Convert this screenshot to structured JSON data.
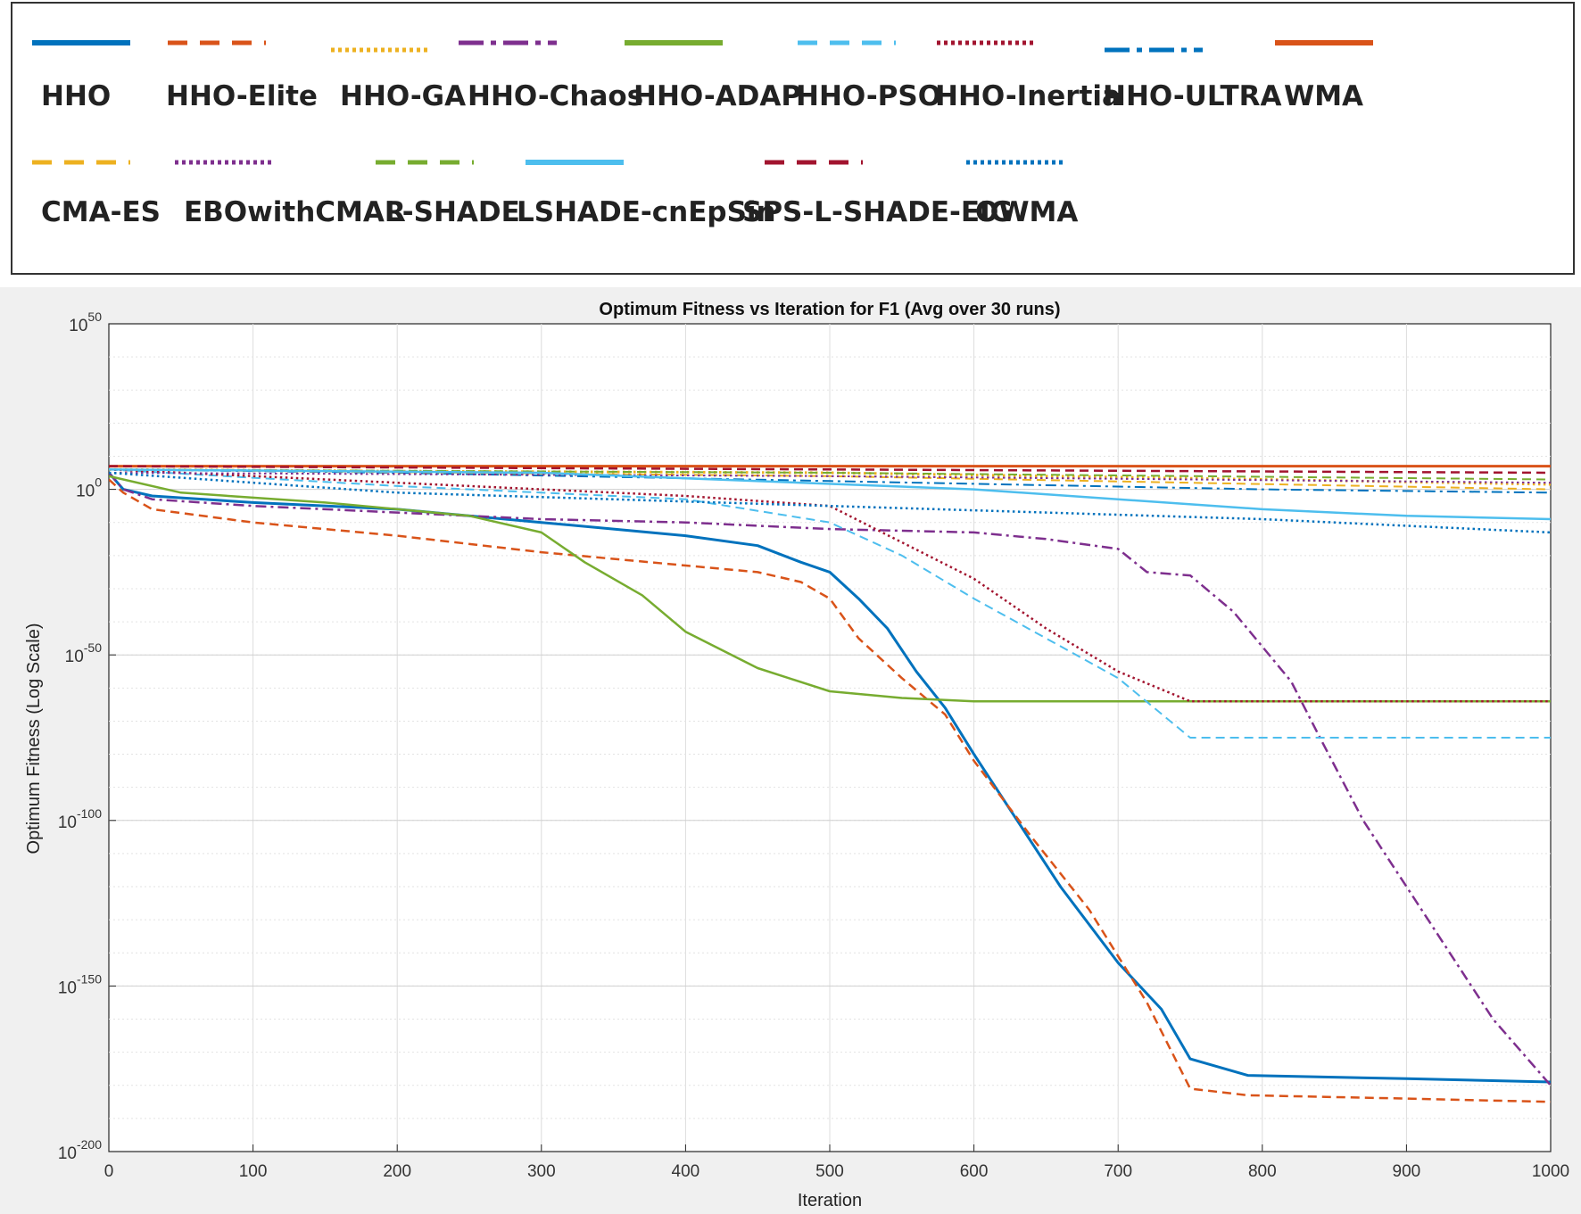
{
  "chart_data": {
    "type": "line",
    "title": "Optimum Fitness vs Iteration for F1 (Avg over 30 runs)",
    "xlabel": "Iteration",
    "ylabel": "Optimum Fitness (Log Scale)",
    "xlim": [
      0,
      1000
    ],
    "ylim_log10": [
      -200,
      50
    ],
    "yscale": "log",
    "grid": true,
    "legend_position": "top",
    "x_ticks": [
      "0",
      "100",
      "200",
      "300",
      "400",
      "500",
      "600",
      "700",
      "800",
      "900",
      "1000"
    ],
    "y_ticks": [
      {
        "base": "10",
        "exp": "50"
      },
      {
        "base": "10",
        "exp": "0"
      },
      {
        "base": "10",
        "exp": "-50"
      },
      {
        "base": "10",
        "exp": "-100"
      },
      {
        "base": "10",
        "exp": "-150"
      },
      {
        "base": "10",
        "exp": "-200"
      }
    ],
    "series": [
      {
        "name": "HHO",
        "color": "#0072bd",
        "dash": "solid",
        "width": 3,
        "points": [
          [
            0,
            5
          ],
          [
            10,
            0
          ],
          [
            30,
            -2
          ],
          [
            100,
            -4
          ],
          [
            200,
            -6
          ],
          [
            300,
            -10
          ],
          [
            350,
            -12
          ],
          [
            400,
            -14
          ],
          [
            450,
            -17
          ],
          [
            480,
            -22
          ],
          [
            500,
            -25
          ],
          [
            520,
            -33
          ],
          [
            540,
            -42
          ],
          [
            560,
            -55
          ],
          [
            580,
            -66
          ],
          [
            600,
            -80
          ],
          [
            630,
            -100
          ],
          [
            660,
            -120
          ],
          [
            700,
            -143
          ],
          [
            730,
            -157
          ],
          [
            750,
            -172
          ],
          [
            790,
            -177
          ],
          [
            900,
            -178
          ],
          [
            1000,
            -179
          ]
        ]
      },
      {
        "name": "HHO-Elite",
        "color": "#d95319",
        "dash": "dashed",
        "width": 2.5,
        "points": [
          [
            0,
            3
          ],
          [
            10,
            -1
          ],
          [
            30,
            -6
          ],
          [
            100,
            -10
          ],
          [
            200,
            -14
          ],
          [
            300,
            -19
          ],
          [
            400,
            -23
          ],
          [
            450,
            -25
          ],
          [
            480,
            -28
          ],
          [
            500,
            -33
          ],
          [
            520,
            -45
          ],
          [
            550,
            -57
          ],
          [
            580,
            -68
          ],
          [
            600,
            -82
          ],
          [
            640,
            -105
          ],
          [
            680,
            -127
          ],
          [
            720,
            -155
          ],
          [
            750,
            -181
          ],
          [
            790,
            -183
          ],
          [
            900,
            -184
          ],
          [
            1000,
            -185
          ]
        ]
      },
      {
        "name": "HHO-GA",
        "color": "#edb120",
        "dash": "dotted",
        "width": 3,
        "points": [
          [
            0,
            6
          ],
          [
            200,
            5.5
          ],
          [
            500,
            5
          ],
          [
            800,
            3
          ],
          [
            1000,
            1.5
          ]
        ]
      },
      {
        "name": "HHO-Chaos",
        "color": "#7e2f8e",
        "dash": "dashdot",
        "width": 2.5,
        "points": [
          [
            0,
            5
          ],
          [
            10,
            0
          ],
          [
            30,
            -3
          ],
          [
            100,
            -5
          ],
          [
            200,
            -7
          ],
          [
            300,
            -9
          ],
          [
            400,
            -10
          ],
          [
            500,
            -12
          ],
          [
            600,
            -13
          ],
          [
            650,
            -15
          ],
          [
            700,
            -18
          ],
          [
            720,
            -25
          ],
          [
            750,
            -26
          ],
          [
            780,
            -37
          ],
          [
            820,
            -58
          ],
          [
            840,
            -75
          ],
          [
            870,
            -100
          ],
          [
            900,
            -120
          ],
          [
            930,
            -140
          ],
          [
            960,
            -160
          ],
          [
            1000,
            -180
          ]
        ]
      },
      {
        "name": "HHO-ADAP",
        "color": "#77ac30",
        "dash": "solid",
        "width": 2.5,
        "points": [
          [
            0,
            4
          ],
          [
            50,
            -1
          ],
          [
            150,
            -4
          ],
          [
            250,
            -8
          ],
          [
            300,
            -13
          ],
          [
            330,
            -22
          ],
          [
            370,
            -32
          ],
          [
            400,
            -43
          ],
          [
            450,
            -54
          ],
          [
            500,
            -61
          ],
          [
            550,
            -63
          ],
          [
            600,
            -64
          ],
          [
            1000,
            -64
          ]
        ]
      },
      {
        "name": "HHO-PSO",
        "color": "#4dbeee",
        "dash": "dashed",
        "width": 2,
        "points": [
          [
            0,
            6
          ],
          [
            200,
            1
          ],
          [
            400,
            -3
          ],
          [
            500,
            -10
          ],
          [
            550,
            -20
          ],
          [
            600,
            -33
          ],
          [
            650,
            -45
          ],
          [
            700,
            -57
          ],
          [
            750,
            -75
          ],
          [
            1000,
            -75
          ]
        ]
      },
      {
        "name": "HHO-Inertia",
        "color": "#a2142f",
        "dash": "dotted",
        "width": 2.5,
        "points": [
          [
            0,
            6
          ],
          [
            200,
            2
          ],
          [
            400,
            -2
          ],
          [
            500,
            -5
          ],
          [
            550,
            -16
          ],
          [
            600,
            -27
          ],
          [
            650,
            -42
          ],
          [
            700,
            -55
          ],
          [
            750,
            -64
          ],
          [
            1000,
            -64
          ]
        ]
      },
      {
        "name": "HHO-ULTRA",
        "color": "#0072bd",
        "dash": "dashdot",
        "width": 2,
        "points": [
          [
            0,
            6
          ],
          [
            200,
            5
          ],
          [
            500,
            2.5
          ],
          [
            800,
            0
          ],
          [
            1000,
            -1
          ]
        ]
      },
      {
        "name": "WMA",
        "color": "#d95319",
        "dash": "solid",
        "width": 3,
        "points": [
          [
            0,
            7
          ],
          [
            500,
            7
          ],
          [
            1000,
            7
          ]
        ]
      },
      {
        "name": "CMA-ES",
        "color": "#edb120",
        "dash": "dashed",
        "width": 2,
        "points": [
          [
            0,
            6
          ],
          [
            500,
            4
          ],
          [
            1000,
            0
          ]
        ]
      },
      {
        "name": "EBOwithCMAR",
        "color": "#7e2f8e",
        "dash": "dotted",
        "width": 2,
        "points": [
          [
            0,
            5
          ],
          [
            500,
            4
          ],
          [
            1000,
            2
          ]
        ]
      },
      {
        "name": "L-SHADE",
        "color": "#77ac30",
        "dash": "dashed",
        "width": 2,
        "points": [
          [
            0,
            6
          ],
          [
            500,
            5
          ],
          [
            1000,
            3
          ]
        ]
      },
      {
        "name": "LSHADE-cnEpSin",
        "color": "#4dbeee",
        "dash": "solid",
        "width": 2.5,
        "points": [
          [
            0,
            6
          ],
          [
            300,
            5
          ],
          [
            600,
            0
          ],
          [
            800,
            -6
          ],
          [
            900,
            -8
          ],
          [
            1000,
            -9
          ]
        ]
      },
      {
        "name": "SPS-L-SHADE-EIG",
        "color": "#a2142f",
        "dash": "dashed",
        "width": 2.5,
        "points": [
          [
            0,
            7
          ],
          [
            500,
            6
          ],
          [
            1000,
            5
          ]
        ]
      },
      {
        "name": "OWMA",
        "color": "#0072bd",
        "dash": "dotted",
        "width": 2.5,
        "points": [
          [
            0,
            5
          ],
          [
            200,
            -1
          ],
          [
            500,
            -5
          ],
          [
            800,
            -9
          ],
          [
            1000,
            -13
          ]
        ]
      }
    ]
  }
}
